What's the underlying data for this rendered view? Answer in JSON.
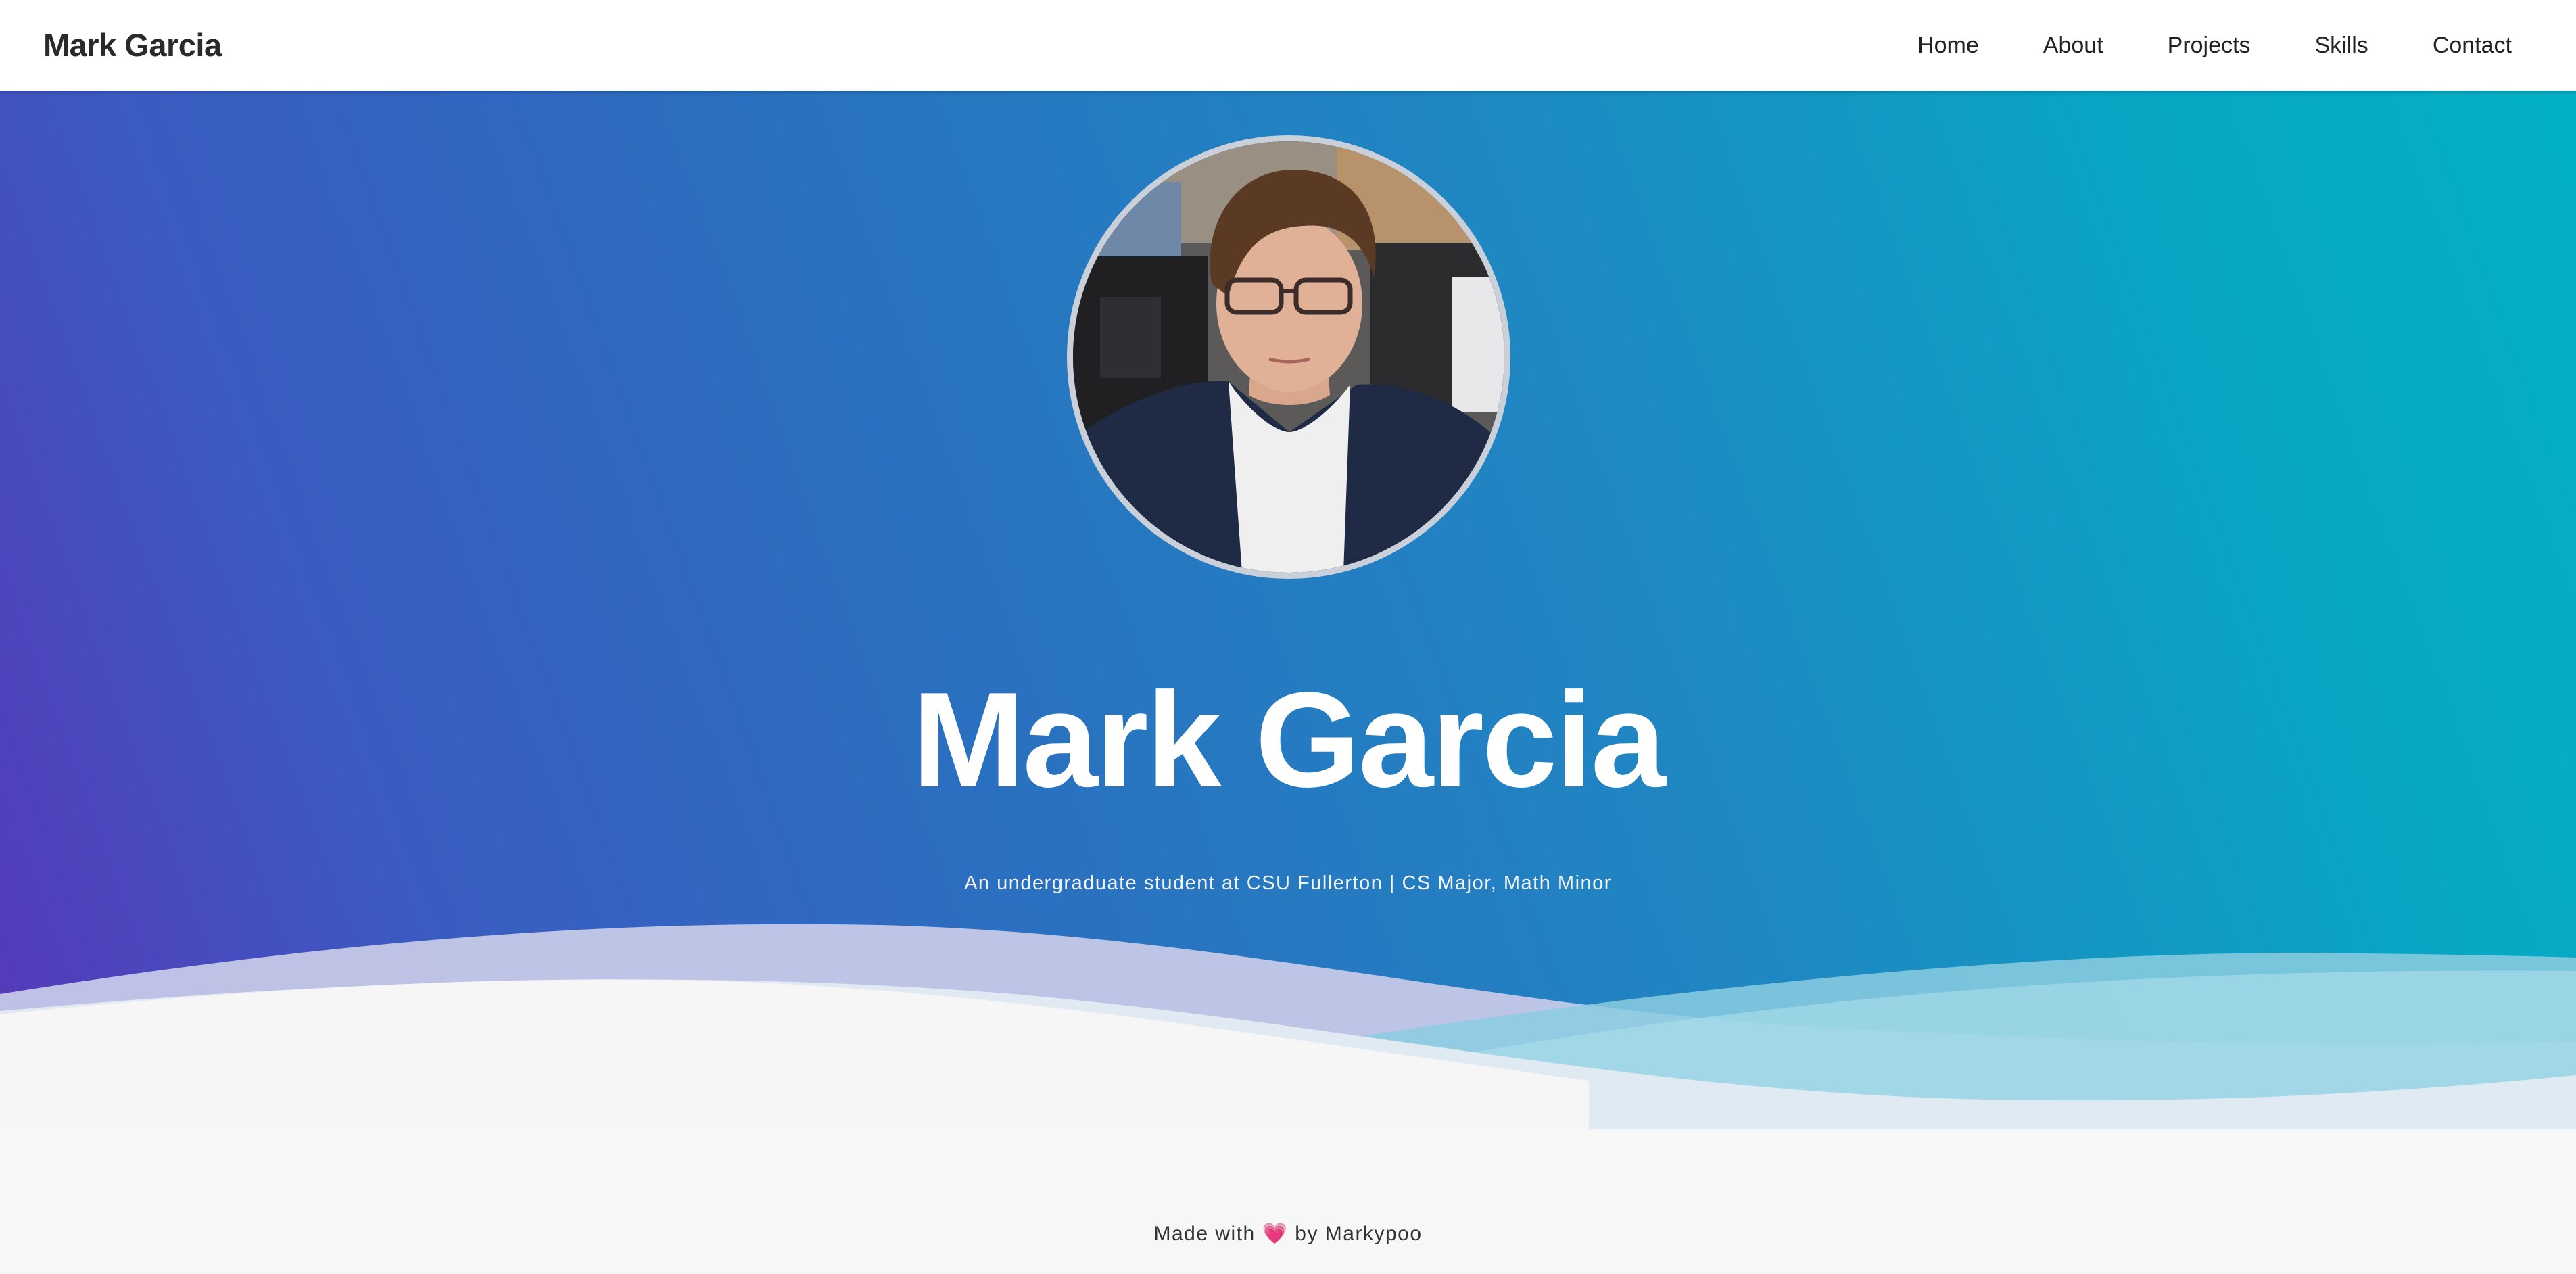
{
  "navbar": {
    "brand": "Mark Garcia",
    "links": [
      {
        "label": "Home"
      },
      {
        "label": "About"
      },
      {
        "label": "Projects"
      },
      {
        "label": "Skills"
      },
      {
        "label": "Contact"
      }
    ]
  },
  "hero": {
    "title": "Mark Garcia",
    "subtitle": "An undergraduate student at CSU Fullerton | CS Major, Math Minor",
    "avatar_icon": "profile-photo",
    "gradient_colors": [
      "#5a33b8",
      "#2b6fc0",
      "#02b1c6"
    ]
  },
  "footer": {
    "prefix": "Made with",
    "heart": "💗",
    "suffix": "by Markypoo"
  }
}
